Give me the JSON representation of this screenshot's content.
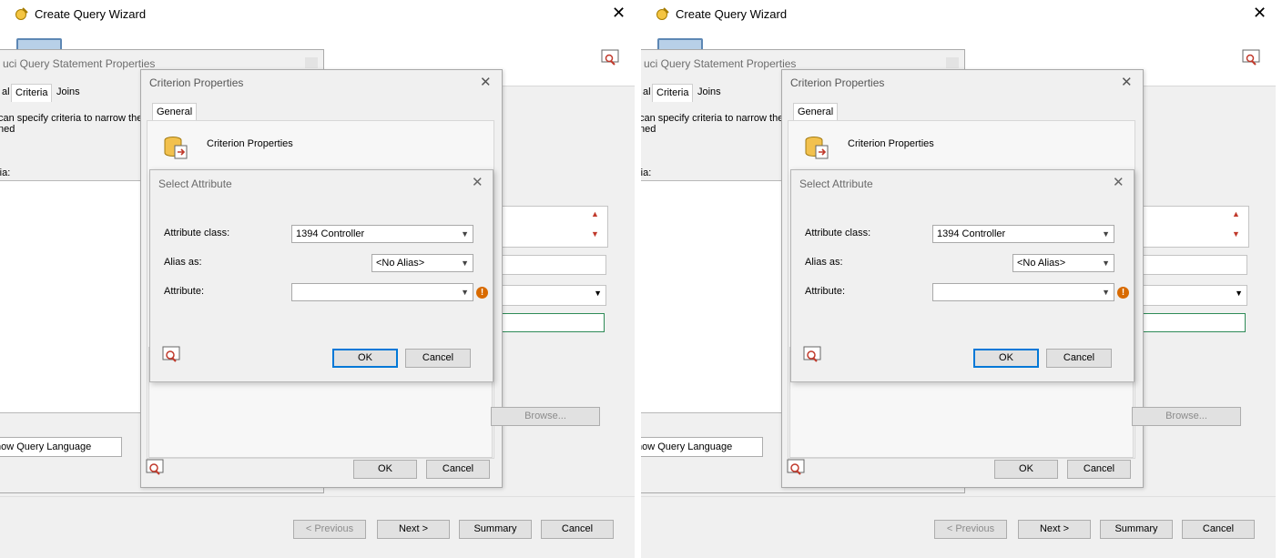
{
  "wizard": {
    "title": "Create Query Wizard",
    "close_glyph": "✕",
    "buttons": {
      "previous": "< Previous",
      "next": "Next >",
      "summary": "Summary",
      "cancel": "Cancel"
    }
  },
  "query_statement": {
    "title": "uci Query Statement Properties",
    "tabs": [
      "al",
      "Criteria",
      "Joins"
    ],
    "description": "can specify criteria to narrow the\nned",
    "criteria_label": "ria:",
    "show_query_language": "how Query Language"
  },
  "criterion_properties": {
    "title": "Criterion Properties",
    "tab": "General",
    "header": "Criterion Properties",
    "close_glyph": "✕",
    "browse": "Browse...",
    "ok": "OK",
    "cancel": "Cancel"
  },
  "select_attribute": {
    "title": "Select Attribute",
    "close_glyph": "✕",
    "attribute_class_label": "Attribute class:",
    "attribute_class_value": "1394 Controller",
    "alias_label": "Alias as:",
    "alias_value": "<No Alias>",
    "attribute_label": "Attribute:",
    "attribute_value": "",
    "warning_glyph": "!",
    "ok": "OK",
    "cancel": "Cancel"
  },
  "glyphs": {
    "dropdown": "▼",
    "up": "▲",
    "down": "▼"
  },
  "icons": [
    "wizard-app-icon",
    "computer-monitor-icon",
    "help-user-icon",
    "database-criterion-icon",
    "warning-icon"
  ],
  "colors": {
    "window_bg": "#f0f0f0",
    "default_button_border": "#0078d7",
    "warning": "#d86a00",
    "icon_accent": "#c0392b"
  }
}
